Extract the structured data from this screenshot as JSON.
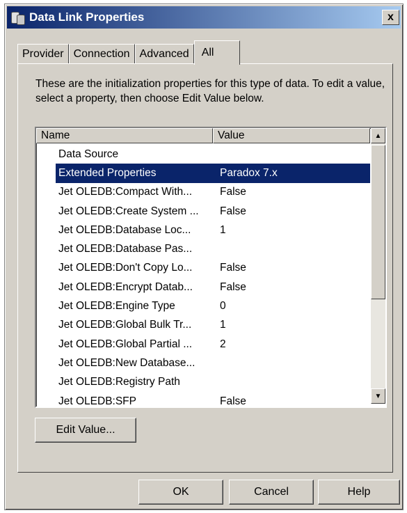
{
  "window": {
    "title": "Data Link Properties",
    "close_label": "x"
  },
  "tabs": [
    {
      "label": "Provider"
    },
    {
      "label": "Connection"
    },
    {
      "label": "Advanced"
    },
    {
      "label": "All"
    }
  ],
  "intro_text": "These are the initialization properties for this type of data. To edit a value, select a property, then choose Edit Value below.",
  "list": {
    "headers": {
      "name": "Name",
      "value": "Value"
    },
    "rows": [
      {
        "name": "Data Source",
        "value": ""
      },
      {
        "name": "Extended Properties",
        "value": "Paradox 7.x"
      },
      {
        "name": "Jet OLEDB:Compact With...",
        "value": "False"
      },
      {
        "name": "Jet OLEDB:Create System ...",
        "value": "False"
      },
      {
        "name": "Jet OLEDB:Database Loc...",
        "value": "1"
      },
      {
        "name": "Jet OLEDB:Database Pas...",
        "value": ""
      },
      {
        "name": "Jet OLEDB:Don't Copy Lo...",
        "value": "False"
      },
      {
        "name": "Jet OLEDB:Encrypt Datab...",
        "value": "False"
      },
      {
        "name": "Jet OLEDB:Engine Type",
        "value": "0"
      },
      {
        "name": "Jet OLEDB:Global Bulk Tr...",
        "value": "1"
      },
      {
        "name": "Jet OLEDB:Global Partial ...",
        "value": "2"
      },
      {
        "name": "Jet OLEDB:New Database...",
        "value": ""
      },
      {
        "name": "Jet OLEDB:Registry Path",
        "value": ""
      },
      {
        "name": "Jet OLEDB:SFP",
        "value": "False"
      }
    ],
    "selected_index": 1
  },
  "buttons": {
    "edit_value": "Edit Value...",
    "ok": "OK",
    "cancel": "Cancel",
    "help": "Help"
  },
  "colors": {
    "selection": "#0a246a",
    "title_bar": "#0a246a",
    "dialog_face": "#d4d0c8"
  }
}
